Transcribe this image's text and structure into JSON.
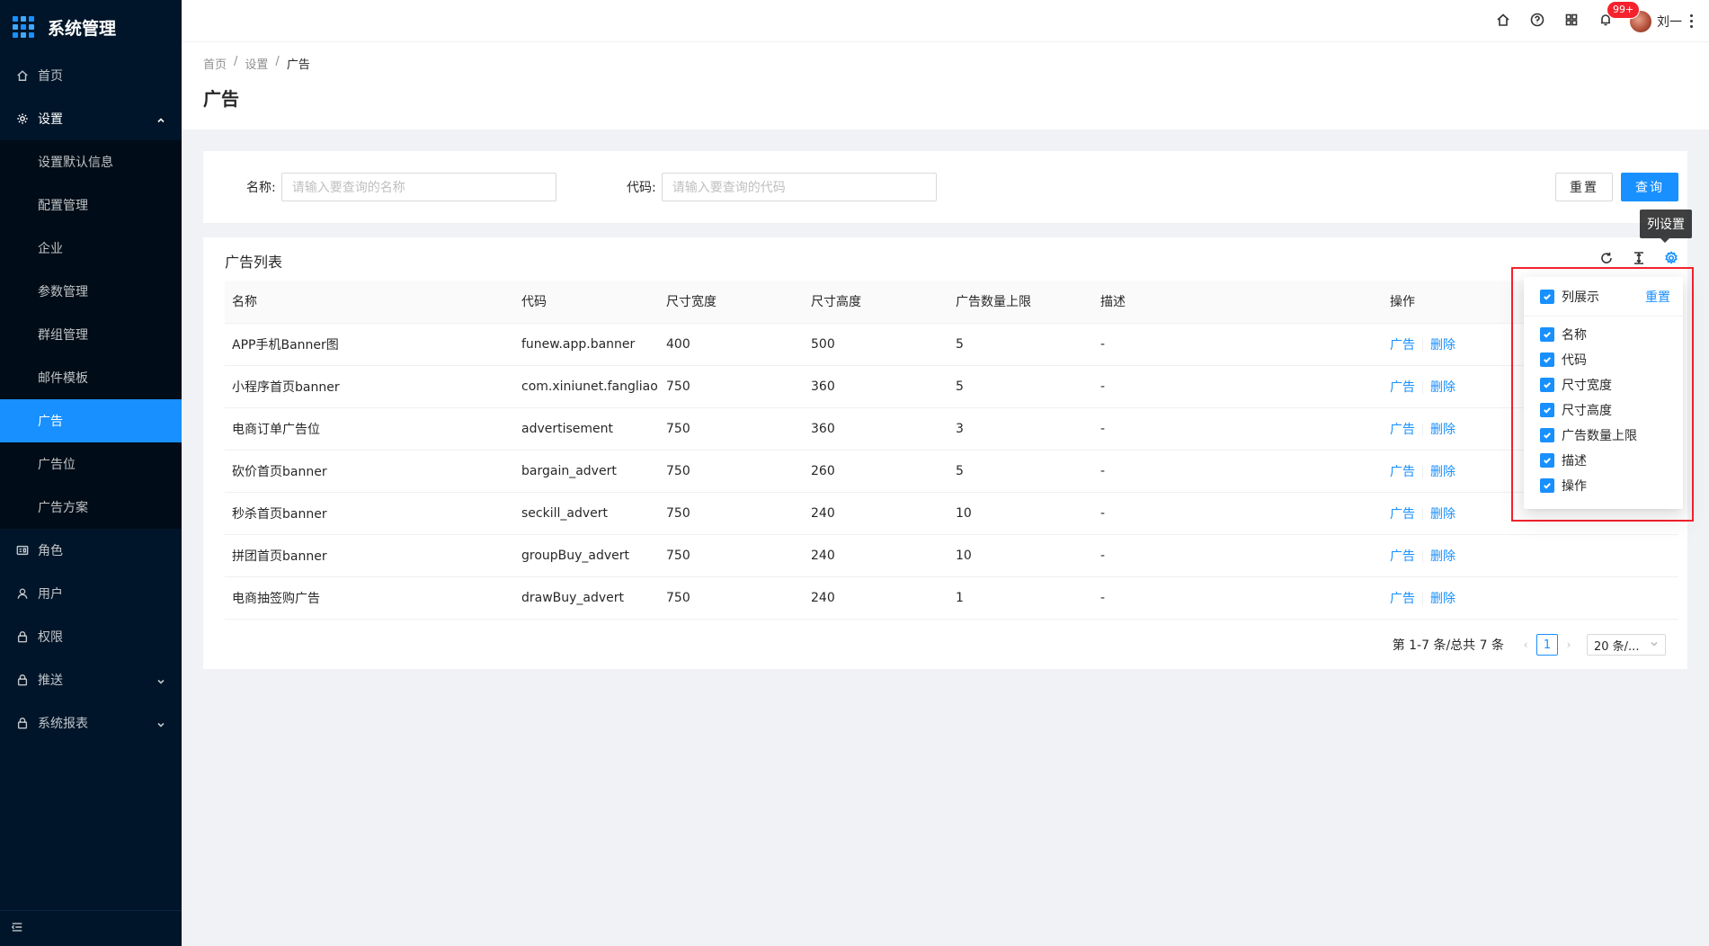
{
  "app": {
    "title": "系统管理"
  },
  "sidebar": {
    "items": [
      {
        "label": "首页"
      },
      {
        "label": "设置"
      },
      {
        "label": "角色"
      },
      {
        "label": "用户"
      },
      {
        "label": "权限"
      },
      {
        "label": "推送"
      },
      {
        "label": "系统报表"
      }
    ],
    "settings_children": [
      "设置默认信息",
      "配置管理",
      "企业",
      "参数管理",
      "群组管理",
      "邮件模板",
      "广告",
      "广告位",
      "广告方案"
    ],
    "selected": "广告"
  },
  "header": {
    "badge": "99+",
    "username": "刘一"
  },
  "breadcrumb": {
    "home": "首页",
    "settings": "设置",
    "current": "广告"
  },
  "page": {
    "title": "广告"
  },
  "search": {
    "name_label": "名称:",
    "name_placeholder": "请输入要查询的名称",
    "code_label": "代码:",
    "code_placeholder": "请输入要查询的代码",
    "reset_label": "重置",
    "query_label": "查询"
  },
  "table": {
    "title": "广告列表",
    "columns": [
      "名称",
      "代码",
      "尺寸宽度",
      "尺寸高度",
      "广告数量上限",
      "描述",
      "操作"
    ],
    "rows": [
      [
        "APP手机Banner图",
        "funew.app.banner",
        "400",
        "500",
        "5",
        "-"
      ],
      [
        "小程序首页banner",
        "com.xiniunet.fangliao",
        "750",
        "360",
        "5",
        "-"
      ],
      [
        "电商订单广告位",
        "advertisement",
        "750",
        "360",
        "3",
        "-"
      ],
      [
        "砍价首页banner",
        "bargain_advert",
        "750",
        "260",
        "5",
        "-"
      ],
      [
        "秒杀首页banner",
        "seckill_advert",
        "750",
        "240",
        "10",
        "-"
      ],
      [
        "拼团首页banner",
        "groupBuy_advert",
        "750",
        "240",
        "10",
        "-"
      ],
      [
        "电商抽签购广告",
        "drawBuy_advert",
        "750",
        "240",
        "1",
        "-"
      ]
    ],
    "action_ad": "广告",
    "action_delete": "删除"
  },
  "pagination": {
    "total_text": "第 1-7 条/总共 7 条",
    "current_page": "1",
    "page_size": "20 条/..."
  },
  "tooltip": {
    "text": "列设置"
  },
  "column_settings": {
    "header_label": "列展示",
    "reset_label": "重置",
    "options": [
      "名称",
      "代码",
      "尺寸宽度",
      "尺寸高度",
      "广告数量上限",
      "描述",
      "操作"
    ]
  },
  "colors": {
    "primary": "#1890ff",
    "sider": "#001529",
    "highlight_box": "#f5222d"
  }
}
